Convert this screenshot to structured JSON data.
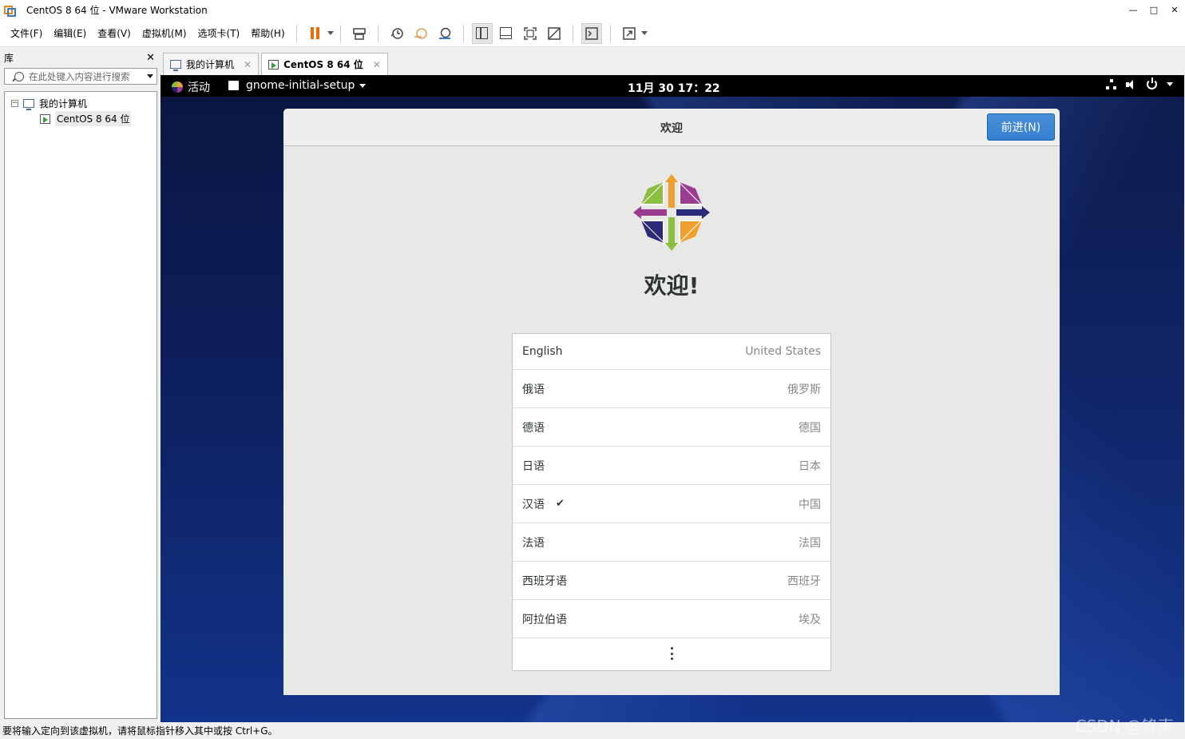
{
  "window": {
    "title": "CentOS 8 64 位 - VMware Workstation"
  },
  "menu": [
    "文件(F)",
    "编辑(E)",
    "查看(V)",
    "虚拟机(M)",
    "选项卡(T)",
    "帮助(H)"
  ],
  "library": {
    "header": "库",
    "close": "✕",
    "search_placeholder": "在此处键入内容进行搜索",
    "tree": {
      "root": "我的计算机",
      "expander": "−",
      "child": "CentOS 8 64 位"
    }
  },
  "tabs": [
    {
      "label": "我的计算机",
      "close": "✕"
    },
    {
      "label": "CentOS 8 64 位",
      "close": "✕"
    }
  ],
  "gnome": {
    "activities": "活动",
    "app_menu": "gnome-initial-setup",
    "clock": "11月 30  17：22"
  },
  "dialog": {
    "title": "欢迎",
    "next_button": "前进(N)",
    "welcome": "欢迎!",
    "languages": [
      {
        "name": "English",
        "region": "United States",
        "selected": false
      },
      {
        "name": "俄语",
        "region": "俄罗斯",
        "selected": false
      },
      {
        "name": "德语",
        "region": "德国",
        "selected": false
      },
      {
        "name": "日语",
        "region": "日本",
        "selected": false
      },
      {
        "name": "汉语",
        "region": "中国",
        "selected": true,
        "check": "✔"
      },
      {
        "name": "法语",
        "region": "法国",
        "selected": false
      },
      {
        "name": "西班牙语",
        "region": "西班牙",
        "selected": false
      },
      {
        "name": "阿拉伯语",
        "region": "埃及",
        "selected": false
      }
    ]
  },
  "statusbar": "要将输入定向到该虚拟机，请将鼠标指针移入其中或按 Ctrl+G。",
  "watermark": "CSDN @锋声",
  "colors": {
    "accent": "#3a87d6",
    "vm_bg": "#0d1f5c",
    "pause": "#f06a00"
  }
}
